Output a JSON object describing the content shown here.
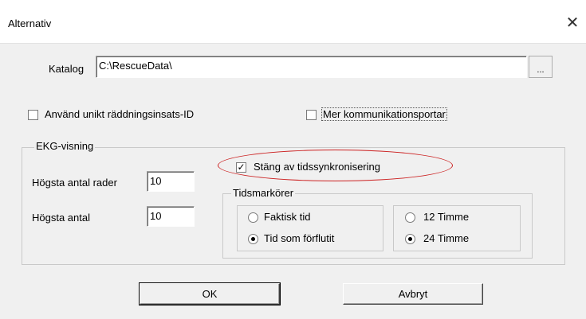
{
  "window": {
    "title": "Alternativ",
    "close_glyph": "✕"
  },
  "directory": {
    "label": "Katalog",
    "value": "C:\\RescueData\\",
    "browse_label": "..."
  },
  "options": {
    "unique_id_label": "Använd unikt räddningsinsats-ID",
    "unique_id_checked": false,
    "more_ports_label": "Mer kommunikationsportar",
    "more_ports_checked": false
  },
  "ekg": {
    "legend": "EKG-visning",
    "max_rows_label": "Högsta antal rader",
    "max_rows_value": "10",
    "max_label": "Högsta antal",
    "max_value": "10",
    "disable_sync_label": "Stäng av tidssynkronisering",
    "disable_sync_checked": true,
    "time_markers": {
      "legend": "Tidsmarkörer",
      "actual_time_label": "Faktisk tid",
      "elapsed_time_label": "Tid som förflutit",
      "selected_mode": "elapsed",
      "hour12_label": "12 Timme",
      "hour24_label": "24 Timme",
      "selected_clock": "24"
    }
  },
  "buttons": {
    "ok_label": "OK",
    "cancel_label": "Avbryt"
  },
  "colors": {
    "highlight": "#cc2222"
  }
}
